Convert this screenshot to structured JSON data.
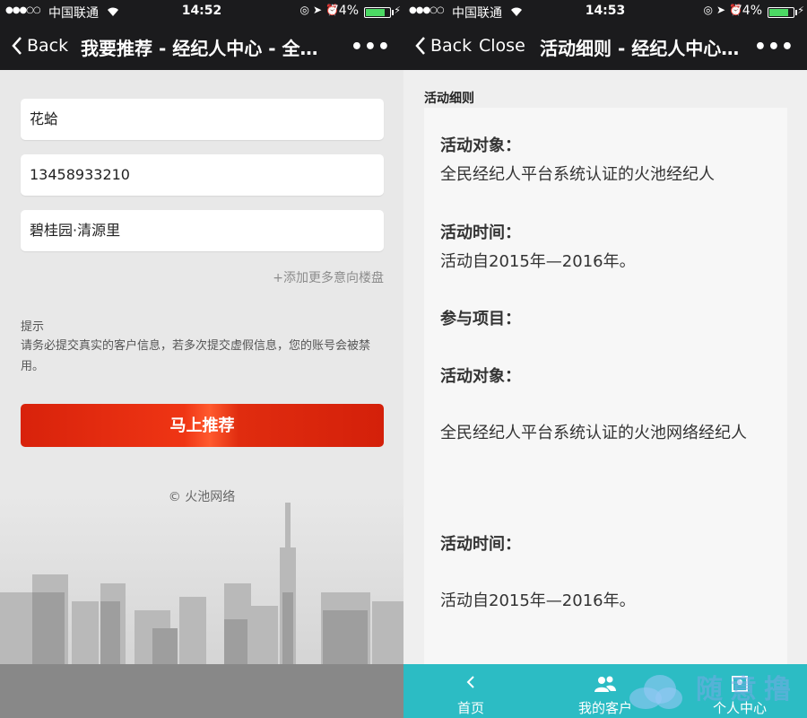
{
  "left": {
    "status": {
      "carrier": "中国联通",
      "time": "14:52",
      "battery": "74%",
      "battery_level": 0.74
    },
    "nav": {
      "back": "Back",
      "title": "我要推荐 - 经纪人中心 - 全…",
      "more": "•••"
    },
    "form": {
      "name_value": "花蛤",
      "phone_value": "13458933210",
      "property_value": "碧桂园·清源里",
      "add_more": "+添加更多意向楼盘",
      "tip_title": "提示",
      "tip_text": "请务必提交真实的客户信息，若多次提交虚假信息，您的账号会被禁用。",
      "submit": "马上推荐"
    },
    "copyright": "© 火池网络"
  },
  "right": {
    "status": {
      "carrier": "中国联通",
      "time": "14:53",
      "battery": "74%",
      "battery_level": 0.74
    },
    "nav": {
      "back": "Back",
      "close": "Close",
      "title": "活动细则 - 经纪人中心…",
      "more": "•••"
    },
    "section_title": "活动细则",
    "content": {
      "l1": "活动对象：",
      "l2": "全民经纪人平台系统认证的火池经纪人",
      "l3": "活动时间：",
      "l4": "活动自2015年—2016年。",
      "l5": "参与项目：",
      "l6": "活动对象：",
      "l7": "全民经纪人平台系统认证的火池网络经纪人",
      "l8": "活动时间：",
      "l9": "活动自2015年—2016年。"
    },
    "tabs": [
      {
        "label": "首页",
        "icon": "chevron-left-icon"
      },
      {
        "label": "我的客户",
        "icon": "users-icon"
      },
      {
        "label": "个人中心",
        "icon": "user-center-icon"
      }
    ],
    "watermark": "随意撸"
  }
}
